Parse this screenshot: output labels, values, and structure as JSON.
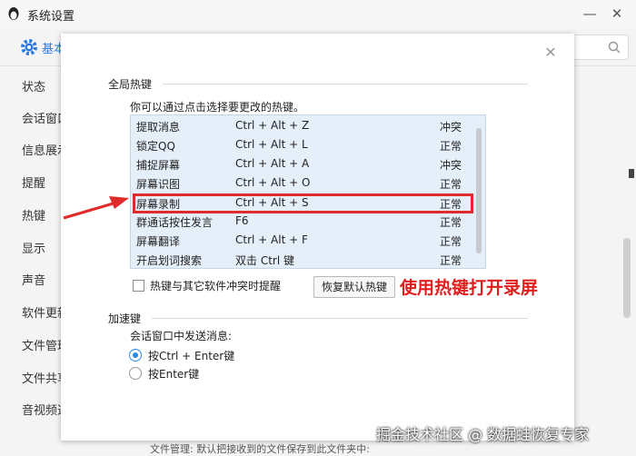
{
  "window": {
    "title": "系统设置",
    "tab_basic": "基本",
    "sidebar": [
      "状态",
      "会话窗口",
      "信息展示",
      "提醒",
      "热键",
      "显示",
      "声音",
      "软件更新",
      "文件管理",
      "文件共享",
      "音视频通"
    ],
    "footer_text": "文件管理:    默认把接收到的文件保存到此文件夹中:"
  },
  "dialog": {
    "global_section": "全局热键",
    "description": "你可以通过点击选择要更改的热键。",
    "hotkeys": [
      {
        "name": "提取消息",
        "keys": "Ctrl + Alt + Z",
        "status": "冲突"
      },
      {
        "name": "锁定QQ",
        "keys": "Ctrl + Alt + L",
        "status": "正常"
      },
      {
        "name": "捕捉屏幕",
        "keys": "Ctrl + Alt + A",
        "status": "冲突"
      },
      {
        "name": "屏幕识图",
        "keys": "Ctrl + Alt + O",
        "status": "正常"
      },
      {
        "name": "屏幕录制",
        "keys": "Ctrl + Alt + S",
        "status": "正常"
      },
      {
        "name": "群通话按住发言",
        "keys": "F6",
        "status": "正常"
      },
      {
        "name": "屏幕翻译",
        "keys": "Ctrl + Alt + F",
        "status": "正常"
      },
      {
        "name": "开启划词搜索",
        "keys": "双击 Ctrl 键",
        "status": "正常"
      }
    ],
    "conflict_checkbox": "热键与其它软件冲突时提醒",
    "restore_button": "恢复默认热键",
    "annotation": "使用热键打开录屏",
    "accel_section": "加速键",
    "send_label": "会话窗口中发送消息:",
    "send_options": [
      "按Ctrl + Enter键",
      "按Enter键"
    ],
    "selected_option": 0
  },
  "watermark": "掘金技术社区 @ 数据蛙恢复专家",
  "colors": {
    "accent": "#2a8ae8",
    "highlight_border": "#e12a2a",
    "list_bg": "#e5eff9"
  }
}
